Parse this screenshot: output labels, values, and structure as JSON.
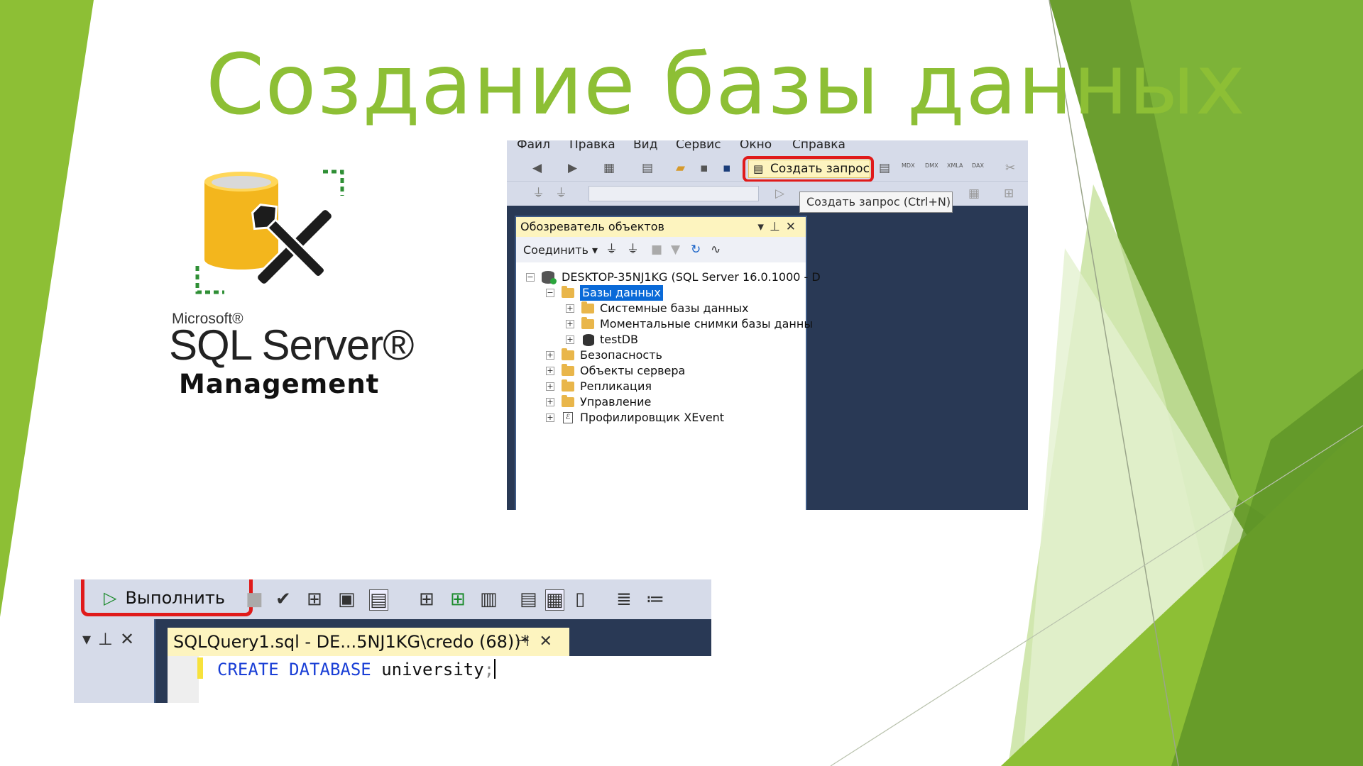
{
  "slide": {
    "title": "Создание базы данных",
    "colors": {
      "title": "#8dbf35",
      "accent_dark": "#5d9e2a",
      "accent_light": "#c7e39a"
    }
  },
  "logo": {
    "microsoft": "Microsoft®",
    "product": "SQL Server®",
    "subtitle": "Management",
    "icon": "database-tools-icon"
  },
  "ssms_main": {
    "menu": [
      "Файл",
      "Правка",
      "Вид",
      "Сервис",
      "Окно",
      "Справка"
    ],
    "toolbar": {
      "new_query_label": "Создать запрос",
      "tooltip": "Создать запрос (Ctrl+N)",
      "icons": [
        "back-icon",
        "forward-icon",
        "new-project-icon",
        "add-item-icon",
        "open-icon",
        "save-icon",
        "save-all-icon",
        "mdx-query-icon",
        "dmx-query-icon",
        "xmla-query-icon",
        "dax-query-icon",
        "cut-icon"
      ],
      "icon_labels": [
        "MDX",
        "DMX",
        "XMLA",
        "DAX"
      ]
    },
    "object_explorer": {
      "title": "Обозреватель объектов",
      "connect_label": "Соединить",
      "server": "DESKTOP-35NJ1KG (SQL Server 16.0.1000 - D",
      "databases_label": "Базы данных",
      "databases_children": [
        "Системные базы данных",
        "Моментальные снимки базы данны",
        "testDB"
      ],
      "folders": [
        "Безопасность",
        "Объекты сервера",
        "Репликация",
        "Управление",
        "Профилировщик XEvent"
      ]
    }
  },
  "ssms_query": {
    "execute_label": "Выполнить",
    "tab_label": "SQLQuery1.sql - DE...5NJ1KG\\credo (68))*",
    "code": {
      "kw1": "CREATE",
      "kw2": "DATABASE",
      "name": "university",
      "punct": ";"
    }
  }
}
